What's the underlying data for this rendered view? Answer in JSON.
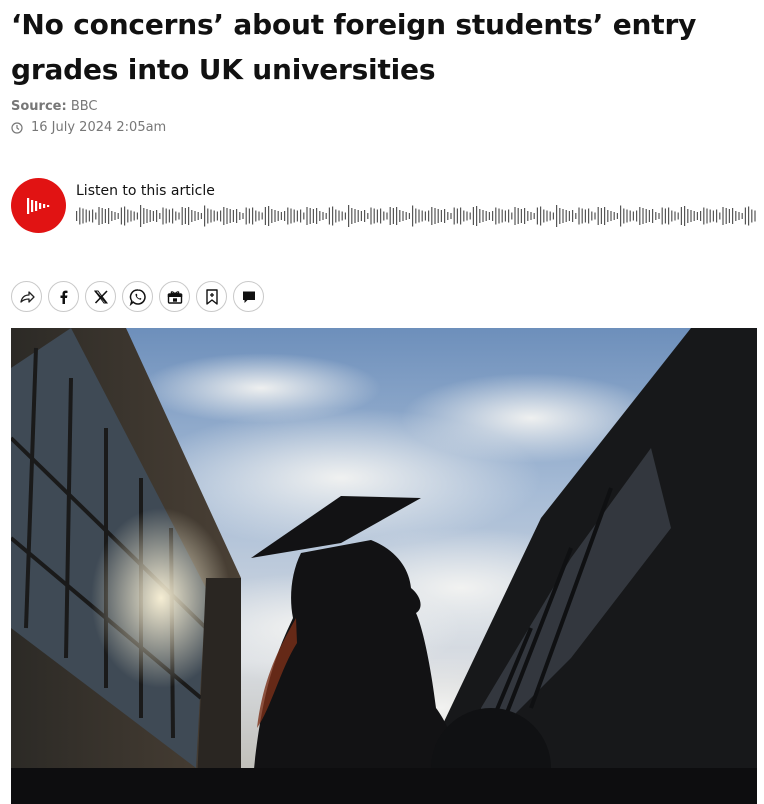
{
  "article": {
    "headline": "‘No concerns’ about foreign students’ entry grades into UK universities",
    "source_label": "Source:",
    "source_name": "BBC",
    "date": "16 July 2024 2:05am"
  },
  "audio": {
    "label": "Listen to this article",
    "accent_color": "#e11313"
  },
  "share": {
    "buttons": [
      {
        "name": "share-icon"
      },
      {
        "name": "facebook-icon"
      },
      {
        "name": "x-twitter-icon"
      },
      {
        "name": "whatsapp-icon"
      },
      {
        "name": "gift-article-icon"
      },
      {
        "name": "bookmark-icon"
      },
      {
        "name": "comment-icon"
      }
    ]
  },
  "hero_image": {
    "subject": "graduate-silhouette"
  }
}
